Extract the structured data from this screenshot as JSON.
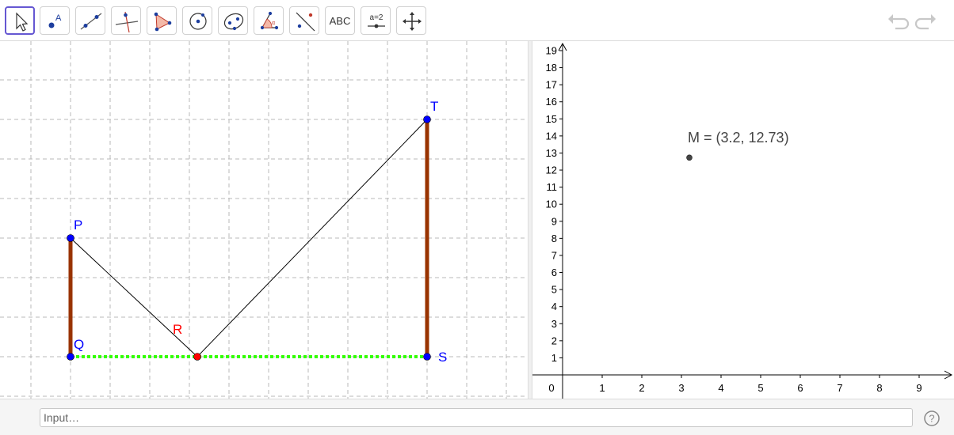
{
  "toolbar": {
    "tools": [
      {
        "name": "move-tool",
        "icon": "arrow-cursor-icon"
      },
      {
        "name": "point-tool",
        "icon": "point-icon"
      },
      {
        "name": "line-tool",
        "icon": "line-through-points-icon"
      },
      {
        "name": "perpendicular-line-tool",
        "icon": "perpendicular-line-icon"
      },
      {
        "name": "polygon-tool",
        "icon": "polygon-icon"
      },
      {
        "name": "circle-center-point-tool",
        "icon": "circle-center-icon"
      },
      {
        "name": "ellipse-tool",
        "icon": "ellipse-icon"
      },
      {
        "name": "angle-tool",
        "icon": "angle-icon"
      },
      {
        "name": "reflect-tool",
        "icon": "reflect-about-line-icon"
      },
      {
        "name": "text-tool",
        "label": "ABC"
      },
      {
        "name": "slider-tool",
        "label": "a=2"
      },
      {
        "name": "move-graphics-view-tool",
        "icon": "move-cross-arrows-icon"
      }
    ],
    "undo_icon": "undo-icon",
    "redo_icon": "redo-icon"
  },
  "graphics": {
    "points": [
      {
        "label": "P",
        "color": "#0000ff"
      },
      {
        "label": "Q",
        "color": "#0000ff"
      },
      {
        "label": "R",
        "color": "#ff0000"
      },
      {
        "label": "S",
        "color": "#0000ff"
      },
      {
        "label": "T",
        "color": "#0000ff"
      }
    ],
    "segment_color": "#993300",
    "dotted_color": "#33ff00"
  },
  "graphics2": {
    "point_label": "M = (3.2, 12.73)",
    "point": {
      "x": 3.2,
      "y": 12.73
    },
    "x_ticks": [
      "0",
      "1",
      "2",
      "3",
      "4",
      "5",
      "6",
      "7",
      "8",
      "9"
    ],
    "y_ticks": [
      "1",
      "2",
      "3",
      "4",
      "5",
      "6",
      "7",
      "8",
      "9",
      "10",
      "11",
      "12",
      "13",
      "14",
      "15",
      "16",
      "17",
      "18",
      "19"
    ]
  },
  "input_bar": {
    "placeholder": "Input…",
    "help_icon": "help-question-icon"
  }
}
